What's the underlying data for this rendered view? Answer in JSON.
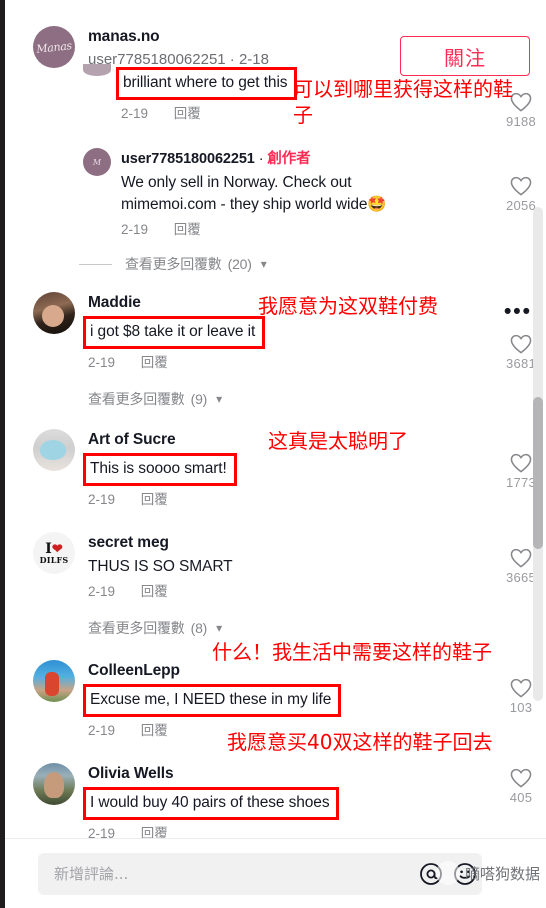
{
  "app": {
    "platform_accent": "#fe2c55",
    "annotation_color": "#ff0000",
    "watermark": "嘀嗒狗数据"
  },
  "header": {
    "username": "manas.no",
    "subtitle": "user7785180062251 · 2-18",
    "follow_label": "關注"
  },
  "labels": {
    "reply": "回覆",
    "creator": "創作者",
    "chevron": "⌄"
  },
  "comments": [
    {
      "id": "partial-top",
      "nested": true,
      "partial": true,
      "avatar": "av-partial",
      "username": "",
      "text": "brilliant where to get this",
      "boxed": true,
      "date": "2-19",
      "reply": "回覆",
      "likes": "9188",
      "annotation": "可以到哪里获得这样的鞋\n子"
    },
    {
      "id": "creator-reply",
      "nested": true,
      "avatar": "av-manas-sm",
      "username": "user7785180062251",
      "creator_badge": "創作者",
      "text": "We only sell in Norway. Check out mimemoi.com - they ship world wide🤩",
      "boxed": false,
      "date": "2-19",
      "reply": "回覆",
      "likes": "2056",
      "view_more": "查看更多回覆數",
      "view_more_count": "(20)",
      "view_more_dash": true
    },
    {
      "id": "maddie",
      "nested": false,
      "avatar": "av-maddie",
      "username": "Maddie",
      "text": "i got $8 take it or leave it",
      "boxed": true,
      "date": "2-19",
      "reply": "回覆",
      "likes": "3681",
      "has_more_dots": true,
      "annotation": "我愿意为这双鞋付费",
      "view_more": "查看更多回覆數",
      "view_more_count": "(9)",
      "view_more_dash": false
    },
    {
      "id": "art-of-sucre",
      "nested": false,
      "avatar": "av-sucre",
      "username": "Art of Sucre",
      "text": "This is soooo smart!",
      "boxed": true,
      "date": "2-19",
      "reply": "回覆",
      "likes": "1773",
      "annotation": "这真是太聪明了"
    },
    {
      "id": "secret-meg",
      "nested": false,
      "avatar": "av-meg",
      "username": "secret meg",
      "text": "THUS IS SO SMART",
      "boxed": false,
      "date": "2-19",
      "reply": "回覆",
      "likes": "3665",
      "view_more": "查看更多回覆數",
      "view_more_count": "(8)",
      "view_more_dash": false
    },
    {
      "id": "colleenlepp",
      "nested": false,
      "avatar": "av-colleen",
      "username": "ColleenLepp",
      "text": "Excuse me, I NEED these in my life",
      "boxed": true,
      "date": "2-19",
      "reply": "回覆",
      "likes": "103",
      "annotation": "什么！我生活中需要这样的鞋子"
    },
    {
      "id": "olivia-wells",
      "nested": false,
      "avatar": "av-olivia",
      "username": "Olivia Wells",
      "text": "I would buy 40 pairs of these shoes",
      "boxed": true,
      "date": "2-19",
      "reply": "回覆",
      "likes": "405",
      "annotation": "我愿意买40双这样的鞋子回去"
    }
  ],
  "composer": {
    "placeholder": "新增評論...",
    "mention_icon": "@",
    "emoji_icon": "☺"
  }
}
